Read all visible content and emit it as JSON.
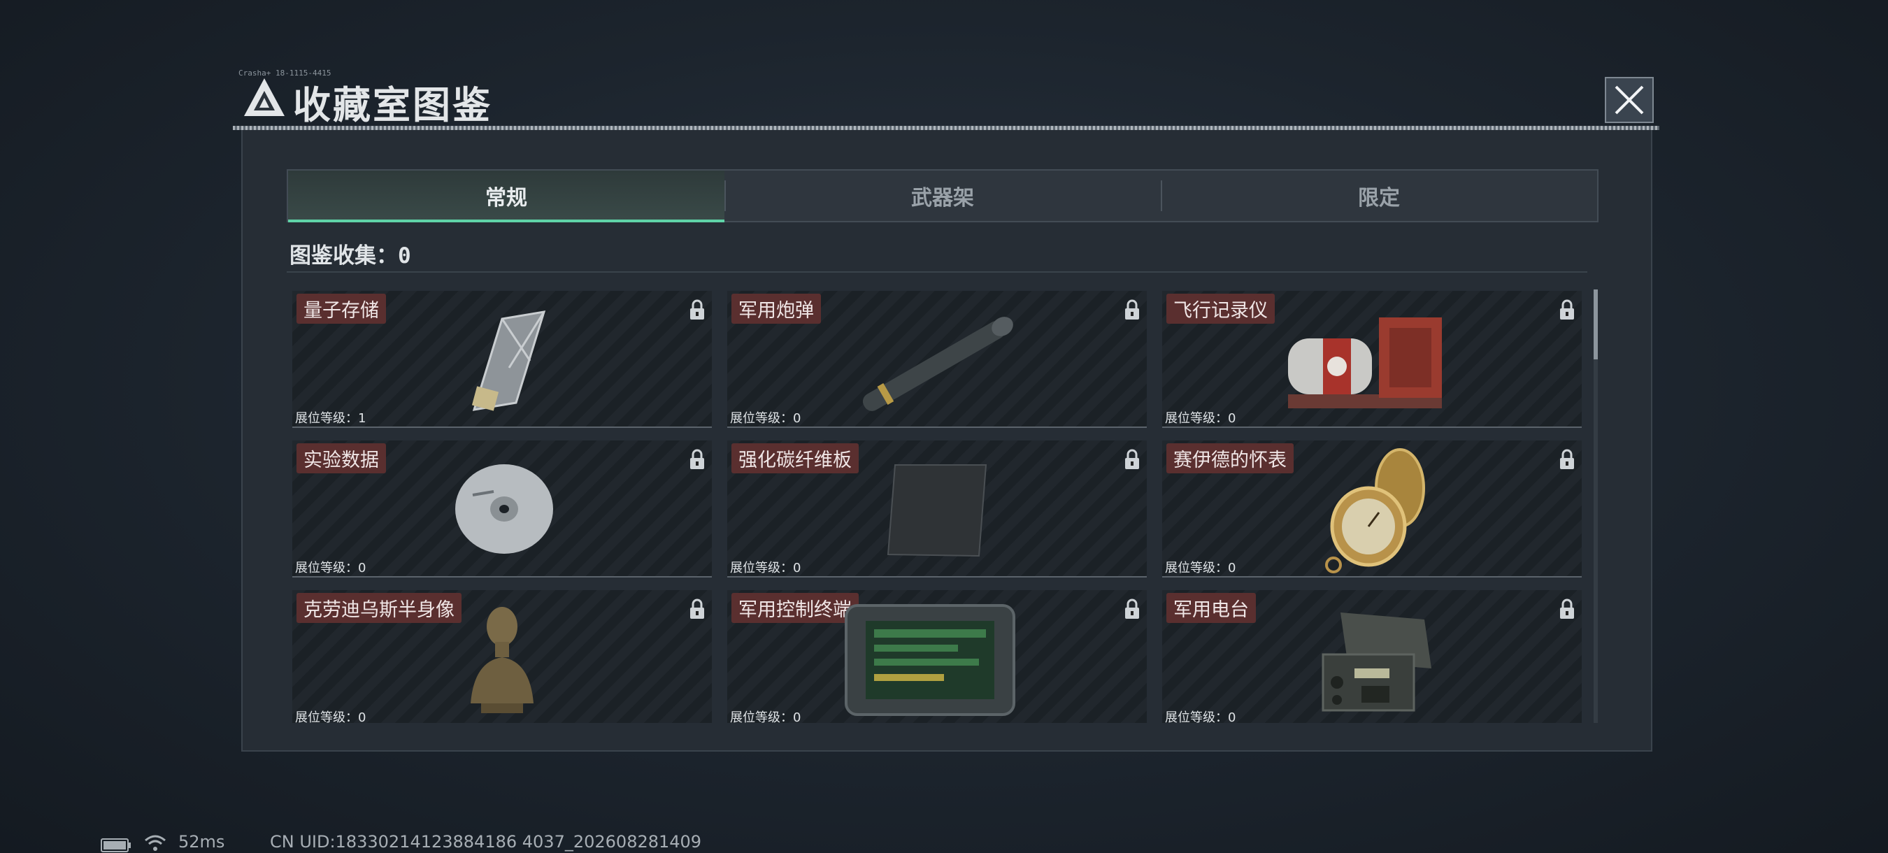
{
  "header": {
    "title": "收藏室图鉴",
    "tiny_code": "Crasha+ 18-1115-4415"
  },
  "tabs": [
    {
      "label": "常规",
      "active": true
    },
    {
      "label": "武器架",
      "active": false
    },
    {
      "label": "限定",
      "active": false
    }
  ],
  "collection": {
    "label": "图鉴收集：",
    "value": "0"
  },
  "items": [
    {
      "name": "量子存储",
      "rank_label": "展位等级：",
      "rank": "1",
      "icon": "usb-drive-icon",
      "locked": true
    },
    {
      "name": "军用炮弹",
      "rank_label": "展位等级：",
      "rank": "0",
      "icon": "artillery-shell-icon",
      "locked": true
    },
    {
      "name": "飞行记录仪",
      "rank_label": "展位等级：",
      "rank": "0",
      "icon": "flight-recorder-icon",
      "locked": true
    },
    {
      "name": "实验数据",
      "rank_label": "展位等级：",
      "rank": "0",
      "icon": "cd-disc-icon",
      "locked": true
    },
    {
      "name": "强化碳纤维板",
      "rank_label": "展位等级：",
      "rank": "0",
      "icon": "carbon-plate-icon",
      "locked": true
    },
    {
      "name": "赛伊德的怀表",
      "rank_label": "展位等级：",
      "rank": "0",
      "icon": "pocket-watch-icon",
      "locked": true
    },
    {
      "name": "克劳迪乌斯半身像",
      "rank_label": "展位等级：",
      "rank": "0",
      "icon": "bust-statue-icon",
      "locked": true
    },
    {
      "name": "军用控制终端",
      "rank_label": "展位等级：",
      "rank": "0",
      "icon": "control-terminal-icon",
      "locked": true
    },
    {
      "name": "军用电台",
      "rank_label": "展位等级：",
      "rank": "0",
      "icon": "military-radio-icon",
      "locked": true
    }
  ],
  "status_bar": {
    "ping": "52ms",
    "uid": "CN UID:18330214123884186 4037_202608281409"
  },
  "colors": {
    "accent": "#5fd3a8",
    "label_bg": "#5a2f2f"
  }
}
